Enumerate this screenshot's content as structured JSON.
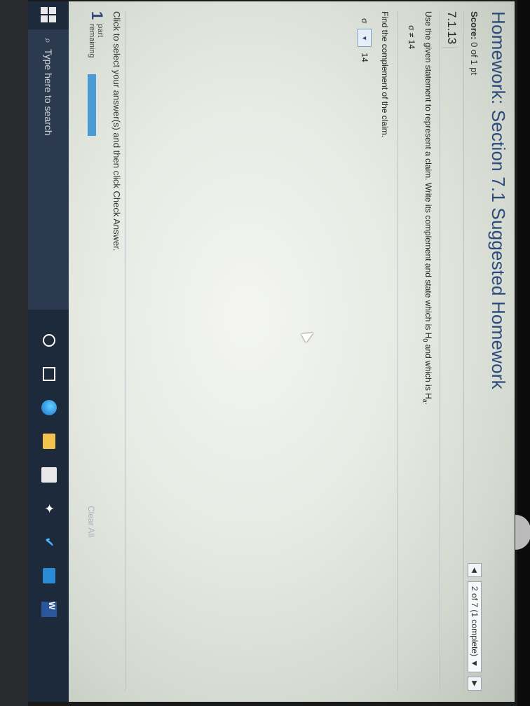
{
  "header": {
    "title": "Homework: Section 7.1 Suggested Homework",
    "score_label": "Score:",
    "score_value": "0 of 1 pt",
    "nav_status": "2 of 7 (1 complete)",
    "prev_icon": "triangle-left-icon",
    "next_icon": "triangle-right-icon"
  },
  "question": {
    "id": "7.1.13",
    "statement_a": "Use the given statement to represent a claim. Write its complement and state which is H",
    "statement_sub0": "0",
    "statement_b": " and which is H",
    "statement_suba": "a",
    "statement_end": ".",
    "claim": "σ ≠ 14",
    "find_label": "Find the complement of the claim.",
    "answer_var": "σ",
    "answer_value": "14"
  },
  "footer": {
    "instruction": "Click to select your answer(s) and then click Check Answer.",
    "parts_count": "1",
    "parts_word": "part",
    "remaining_word": "remaining",
    "progress_fraction": 0,
    "clear_all": "Clear All"
  },
  "taskbar": {
    "search_placeholder": "Type here to search"
  }
}
